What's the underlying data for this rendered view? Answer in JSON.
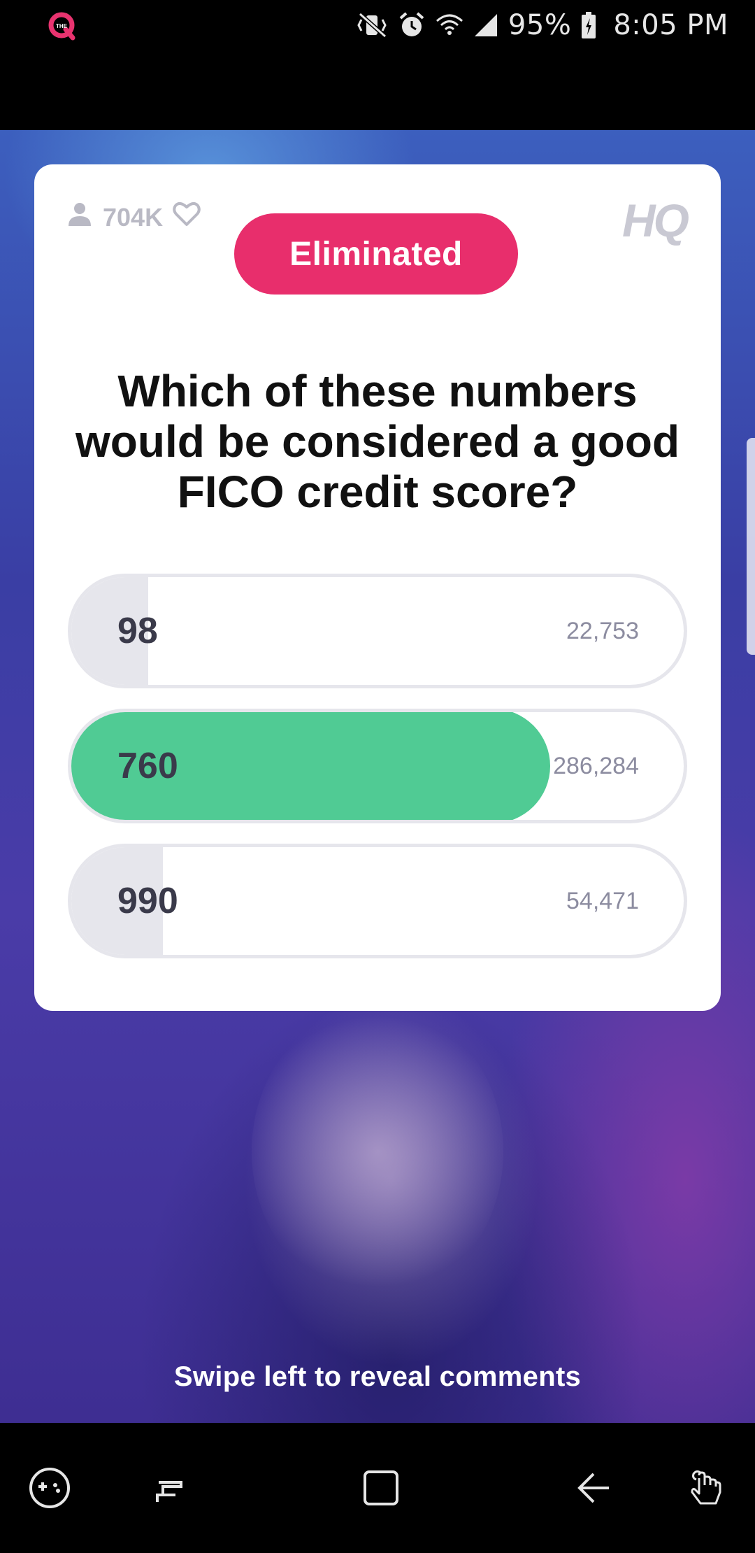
{
  "status_bar": {
    "battery": "95%",
    "time": "8:05 PM",
    "icons": [
      "app-logo-icon",
      "vibrate-mute-icon",
      "alarm-icon",
      "wifi-icon",
      "signal-icon",
      "battery-icon"
    ]
  },
  "game": {
    "viewer_count": "704K",
    "logo": "HQ",
    "status_badge": "Eliminated",
    "question": "Which of these numbers would be considered a good FICO credit score?",
    "answers": [
      {
        "label": "98",
        "count": "22,753",
        "fill_percent": 12.6,
        "correct": false
      },
      {
        "label": "760",
        "count": "286,284",
        "fill_percent": 78.8,
        "correct": true
      },
      {
        "label": "990",
        "count": "54,471",
        "fill_percent": 14.9,
        "correct": false
      }
    ]
  },
  "hint": "Swipe left to reveal comments",
  "colors": {
    "eliminated": "#e82e6c",
    "correct": "#50cb94",
    "muted_fill": "#e6e6ec"
  },
  "nav_bar": {
    "icons": [
      "game-launcher-icon",
      "recents-icon",
      "home-icon",
      "back-icon",
      "gesture-icon"
    ]
  }
}
